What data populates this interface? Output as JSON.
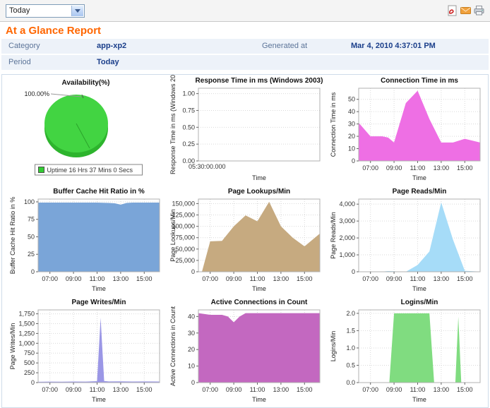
{
  "toolbar": {
    "period_dropdown_value": "Today",
    "icons": [
      "pdf-export-icon",
      "email-icon",
      "print-icon"
    ]
  },
  "report": {
    "title": "At a Glance Report",
    "info": {
      "category_label": "Category",
      "category_value": "app-xp2",
      "generated_label": "Generated at",
      "generated_value": "Mar 4, 2010 4:37:01 PM",
      "period_label": "Period",
      "period_value": "Today"
    }
  },
  "chart_data": [
    {
      "id": "availability",
      "type": "pie",
      "title": "Availability(%)",
      "callout_label": "100.00%",
      "pie_color": "#42d442",
      "pie_side_color": "#2db42d",
      "slices": [
        {
          "label": "Uptime 16 Hrs 37 Mins 0 Secs",
          "value": 100,
          "color": "#33cc33"
        }
      ],
      "legend_position": "bottom"
    },
    {
      "id": "response-time",
      "type": "empty",
      "title": "Response Time in ms (Windows 2003)",
      "ylabel": "Response Time in ms (Windows 20",
      "xlabel": "Time",
      "ylim": [
        0,
        1.08
      ],
      "ytick_vals": [
        0,
        0.25,
        0.5,
        0.75,
        1.0
      ],
      "ytick_labels": [
        "0.00",
        "0.25",
        "0.50",
        "0.75",
        "1.00"
      ],
      "x_corner_label": "05:30:00.000"
    },
    {
      "id": "connection-time",
      "type": "area",
      "title": "Connection Time in ms",
      "ylabel": "Connection Time in ms",
      "xlabel": "Time",
      "color": "#ee6fe4",
      "xlim": [
        6,
        16.3
      ],
      "ylim": [
        0,
        59
      ],
      "ytick_vals": [
        0,
        10,
        20,
        30,
        40,
        50
      ],
      "ytick_labels": [
        "0",
        "10",
        "20",
        "30",
        "40",
        "50"
      ],
      "xtick_vals": [
        7,
        9,
        11,
        13,
        15
      ],
      "xtick_labels": [
        "07:00",
        "09:00",
        "11:00",
        "13:00",
        "15:00"
      ],
      "x": [
        6,
        7,
        8,
        8.5,
        9,
        10,
        11,
        12,
        13,
        14,
        15,
        16.3
      ],
      "values": [
        31,
        20,
        20,
        19,
        15,
        47,
        57,
        34,
        15,
        15,
        18,
        15
      ]
    },
    {
      "id": "buffer-cache-hit-ratio",
      "type": "area",
      "title": "Buffer Cache Hit Ratio in %",
      "ylabel": "Buffer Cache Hit Ratio in %",
      "xlabel": "Time",
      "color": "#7aa5d8",
      "xlim": [
        6,
        16.3
      ],
      "ylim": [
        0,
        104
      ],
      "ytick_vals": [
        0,
        25,
        50,
        75,
        100
      ],
      "ytick_labels": [
        "0",
        "25",
        "50",
        "75",
        "100"
      ],
      "xtick_vals": [
        7,
        9,
        11,
        13,
        15
      ],
      "xtick_labels": [
        "07:00",
        "09:00",
        "11:00",
        "13:00",
        "15:00"
      ],
      "x": [
        6,
        7,
        8,
        9,
        10,
        11,
        12,
        12.5,
        13,
        13.5,
        14,
        15,
        16.3
      ],
      "values": [
        99,
        99,
        99,
        99,
        99,
        99,
        98.5,
        98,
        96,
        98.5,
        99,
        99,
        99
      ]
    },
    {
      "id": "page-lookups-min",
      "type": "area",
      "title": "Page Lookups/Min",
      "ylabel": "Page Lookups/Min",
      "xlabel": "Time",
      "color": "#c6aa80",
      "xlim": [
        6,
        16.3
      ],
      "ylim": [
        0,
        160000
      ],
      "ytick_vals": [
        0,
        25000,
        50000,
        75000,
        100000,
        125000,
        150000
      ],
      "ytick_labels": [
        "0",
        "25,000",
        "50,000",
        "75,000",
        "100,000",
        "125,000",
        "150,000"
      ],
      "xtick_vals": [
        7,
        9,
        11,
        13,
        15
      ],
      "xtick_labels": [
        "07:00",
        "09:00",
        "11:00",
        "13:00",
        "15:00"
      ],
      "x": [
        6.3,
        7,
        8,
        9,
        10,
        11,
        12,
        13,
        14,
        15,
        16.3
      ],
      "values": [
        0,
        67000,
        68000,
        100000,
        124000,
        111000,
        154000,
        100000,
        75000,
        56000,
        84000
      ]
    },
    {
      "id": "page-reads-min",
      "type": "area",
      "title": "Page Reads/Min",
      "ylabel": "Page Reads/Min",
      "xlabel": "Time",
      "color": "#a6dcf8",
      "xlim": [
        6,
        16.3
      ],
      "ylim": [
        0,
        4300
      ],
      "ytick_vals": [
        0,
        1000,
        2000,
        3000,
        4000
      ],
      "ytick_labels": [
        "0",
        "1,000",
        "2,000",
        "3,000",
        "4,000"
      ],
      "xtick_vals": [
        7,
        9,
        11,
        13,
        15
      ],
      "xtick_labels": [
        "07:00",
        "09:00",
        "11:00",
        "13:00",
        "15:00"
      ],
      "x": [
        6,
        7,
        8,
        8.5,
        9,
        9.5,
        10,
        11,
        12,
        13,
        14,
        15,
        16.3
      ],
      "values": [
        0,
        0,
        10,
        40,
        30,
        0,
        0,
        400,
        1200,
        4100,
        1900,
        60,
        10
      ]
    },
    {
      "id": "page-writes-min",
      "type": "area",
      "title": "Page Writes/Min",
      "ylabel": "Page Writes/Min",
      "xlabel": "Time",
      "color": "#9b97e6",
      "xlim": [
        6,
        16.3
      ],
      "ylim": [
        0,
        1850
      ],
      "ytick_vals": [
        0,
        250,
        500,
        750,
        1000,
        1250,
        1500,
        1750
      ],
      "ytick_labels": [
        "0",
        "250",
        "500",
        "750",
        "1,000",
        "1,250",
        "1,500",
        "1,750"
      ],
      "xtick_vals": [
        7,
        9,
        11,
        13,
        15
      ],
      "xtick_labels": [
        "07:00",
        "09:00",
        "11:00",
        "13:00",
        "15:00"
      ],
      "x": [
        6,
        7,
        8,
        9,
        10,
        11,
        11.3,
        11.6,
        12,
        13,
        14,
        15,
        16.3
      ],
      "values": [
        20,
        25,
        22,
        28,
        25,
        35,
        1650,
        40,
        30,
        32,
        28,
        30,
        26
      ]
    },
    {
      "id": "active-connections",
      "type": "area",
      "title": "Active Connections in Count",
      "ylabel": "Active Connections in Count",
      "xlabel": "Time",
      "color": "#c368c0",
      "xlim": [
        6,
        16.3
      ],
      "ylim": [
        0,
        44
      ],
      "ytick_vals": [
        0,
        10,
        20,
        30,
        40
      ],
      "ytick_labels": [
        "0",
        "10",
        "20",
        "30",
        "40"
      ],
      "xtick_vals": [
        7,
        9,
        11,
        13,
        15
      ],
      "xtick_labels": [
        "07:00",
        "09:00",
        "11:00",
        "13:00",
        "15:00"
      ],
      "x": [
        6,
        7,
        8,
        8.5,
        9,
        9.5,
        10,
        11,
        12,
        13,
        14,
        15,
        16.3
      ],
      "values": [
        42,
        41,
        41,
        40,
        36.5,
        40,
        42,
        42,
        42,
        42,
        42,
        42,
        42
      ]
    },
    {
      "id": "logins-min",
      "type": "area",
      "title": "Logins/Min",
      "ylabel": "Logins/Min",
      "xlabel": "Time",
      "color": "#80dc80",
      "xlim": [
        6,
        16.3
      ],
      "ylim": [
        0,
        2.1
      ],
      "ytick_vals": [
        0,
        0.5,
        1.0,
        1.5,
        2.0
      ],
      "ytick_labels": [
        "0.0",
        "0.5",
        "1.0",
        "1.5",
        "2.0"
      ],
      "xtick_vals": [
        7,
        9,
        11,
        13,
        15
      ],
      "xtick_labels": [
        "07:00",
        "09:00",
        "11:00",
        "13:00",
        "15:00"
      ],
      "x": [
        6,
        7,
        8,
        8.6,
        9,
        12,
        12.4,
        14.2,
        14.45,
        14.7,
        15,
        16.3
      ],
      "values": [
        0,
        0,
        0,
        0,
        2,
        2,
        0,
        0,
        1.9,
        0,
        0,
        0
      ]
    }
  ]
}
